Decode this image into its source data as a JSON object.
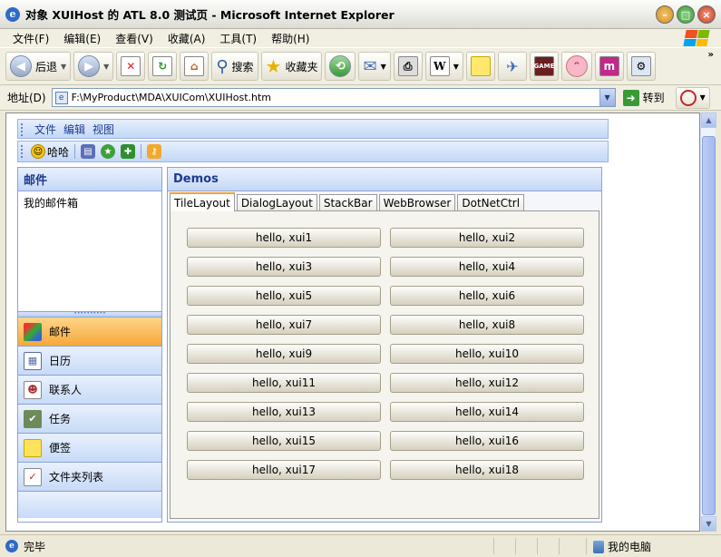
{
  "window": {
    "title": "对象 XUIHost 的 ATL 8.0 测试页 - Microsoft Internet Explorer"
  },
  "ie_menu": [
    "文件(F)",
    "编辑(E)",
    "查看(V)",
    "收藏(A)",
    "工具(T)",
    "帮助(H)"
  ],
  "toolbar": {
    "back_label": "后退",
    "search_label": "搜索",
    "favorites_label": "收藏夹"
  },
  "address": {
    "label": "地址(D)",
    "url": "F:\\MyProduct\\MDA\\XUICom\\XUIHost.htm",
    "go_label": "转到"
  },
  "app": {
    "menu": [
      "文件",
      "编辑",
      "视图"
    ],
    "tool_label": "哈哈",
    "left_title": "邮件",
    "left_items": [
      "我的邮件箱"
    ],
    "nav": [
      {
        "label": "邮件",
        "icon": "mail-icon",
        "active": true
      },
      {
        "label": "日历",
        "icon": "calendar-icon",
        "active": false
      },
      {
        "label": "联系人",
        "icon": "contacts-icon",
        "active": false
      },
      {
        "label": "任务",
        "icon": "tasks-icon",
        "active": false
      },
      {
        "label": "便签",
        "icon": "note-icon",
        "active": false
      },
      {
        "label": "文件夹列表",
        "icon": "folder-list-icon",
        "active": false
      }
    ],
    "right_title": "Demos",
    "tabs": [
      "TileLayout",
      "DialogLayout",
      "StackBar",
      "WebBrowser",
      "DotNetCtrl"
    ],
    "active_tab": "TileLayout",
    "buttons": [
      "hello, xui1",
      "hello, xui2",
      "hello, xui3",
      "hello, xui4",
      "hello, xui5",
      "hello, xui6",
      "hello, xui7",
      "hello, xui8",
      "hello, xui9",
      "hello, xui10",
      "hello, xui11",
      "hello, xui12",
      "hello, xui13",
      "hello, xui14",
      "hello, xui15",
      "hello, xui16",
      "hello, xui17",
      "hello, xui18"
    ]
  },
  "status": {
    "left": "完毕",
    "right": "我的电脑"
  },
  "colors": {
    "accent_orange": "#f6a83b",
    "panel_blue": "#c6d8f6",
    "border_blue": "#8aa2d8"
  }
}
